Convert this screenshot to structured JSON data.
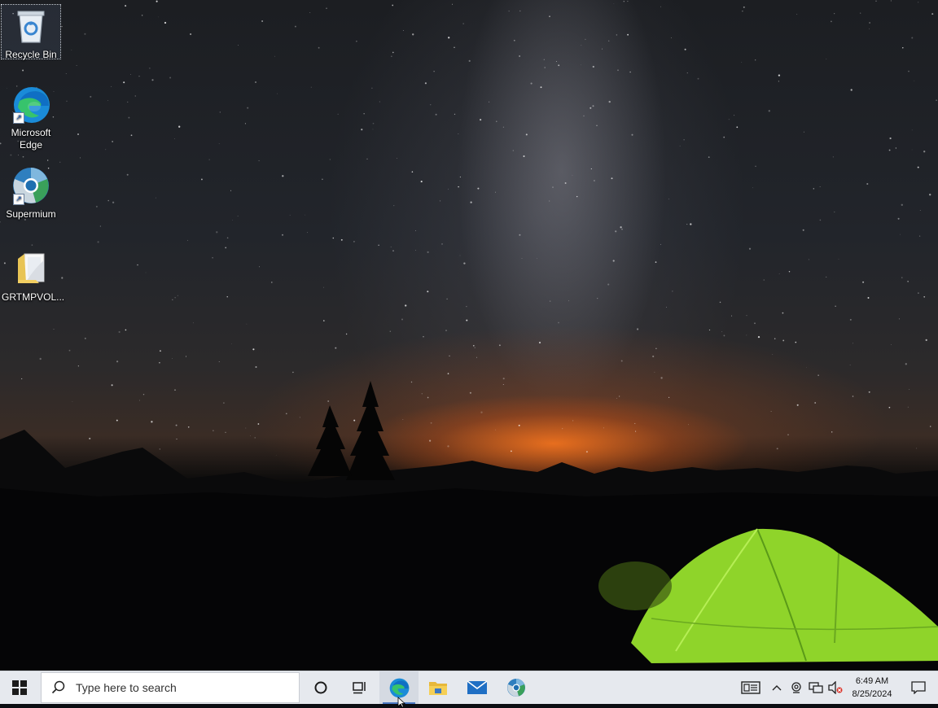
{
  "desktop": {
    "icons": [
      {
        "label": "Recycle Bin",
        "icon": "recycle-bin-icon"
      },
      {
        "label": "Microsoft Edge",
        "icon": "edge-icon"
      },
      {
        "label": "Supermium",
        "icon": "supermium-icon"
      },
      {
        "label": "GRTMPVOL...",
        "icon": "folder-icon"
      }
    ]
  },
  "taskbar": {
    "search_placeholder": "Type here to search",
    "pinned": [
      {
        "name": "Cortana",
        "icon": "cortana-circle-icon"
      },
      {
        "name": "Task View",
        "icon": "task-view-icon"
      },
      {
        "name": "Microsoft Edge",
        "icon": "edge-icon",
        "active": true
      },
      {
        "name": "File Explorer",
        "icon": "file-explorer-icon"
      },
      {
        "name": "Mail",
        "icon": "mail-icon"
      },
      {
        "name": "Supermium",
        "icon": "supermium-icon"
      }
    ]
  },
  "tray": {
    "time": "6:49 AM",
    "date": "8/25/2024",
    "icons": [
      "news-icon",
      "chevron-up-icon",
      "meet-now-icon",
      "network-icon",
      "volume-muted-icon",
      "notification-icon"
    ]
  },
  "colors": {
    "taskbar_bg": "#e6e9ee",
    "active_indicator": "#4a78c2",
    "tent_green": "#9bdc2a",
    "horizon_glow": "#ff7a1e"
  }
}
